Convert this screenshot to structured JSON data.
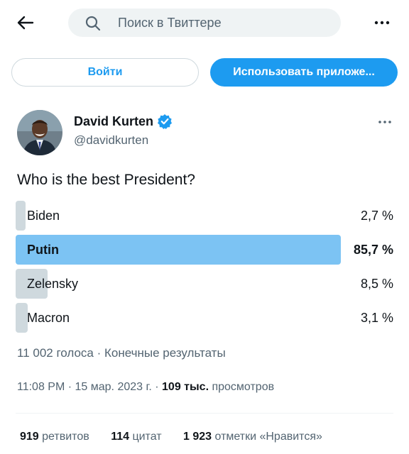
{
  "header": {
    "search_placeholder": "Поиск в Твиттере",
    "back_icon": "arrow-left-icon",
    "more_icon": "more-horizontal-icon"
  },
  "auth": {
    "login_label": "Войти",
    "use_app_label": "Использовать приложе..."
  },
  "tweet": {
    "author": {
      "name": "David Kurten",
      "handle": "@davidkurten",
      "verified": true
    },
    "text": "Who is the best President?",
    "poll": {
      "options": [
        {
          "label": "Biden",
          "percent_text": "2,7 %",
          "fraction": 0.027,
          "winner": false
        },
        {
          "label": "Putin",
          "percent_text": "85,7 %",
          "fraction": 0.857,
          "winner": true
        },
        {
          "label": "Zelensky",
          "percent_text": "8,5 %",
          "fraction": 0.085,
          "winner": false
        },
        {
          "label": "Macron",
          "percent_text": "3,1 %",
          "fraction": 0.031,
          "winner": false
        }
      ],
      "votes_text": "11 002 голоса",
      "separator": " · ",
      "status_text": "Конечные результаты"
    },
    "meta": {
      "time": "11:08 PM",
      "separator": " · ",
      "date": "15 мар. 2023 г.",
      "views_count": "109 тыс.",
      "views_label": " просмотров"
    },
    "stats": {
      "retweets_count": "919",
      "retweets_label": " ретвитов",
      "quotes_count": "114",
      "quotes_label": " цитат",
      "likes_count": "1 923",
      "likes_label": " отметки «Нравится»"
    }
  },
  "colors": {
    "accent": "#1d9bf0",
    "winner_bar": "#7cc3f3",
    "loser_bar": "#cfd9de",
    "secondary_text": "#536471"
  }
}
